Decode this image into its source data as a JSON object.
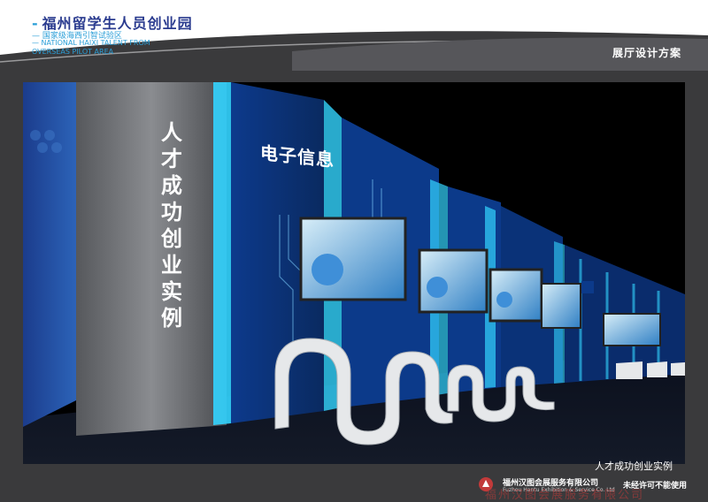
{
  "header": {
    "title": "福州留学生人员创业园",
    "subtitle_cn": "国家级海西引智试验区",
    "subtitle_en_line1": "NATIONAL HAIXI TALENT FROM",
    "subtitle_en_line2": "OVERSEAS PILOT AREA",
    "section_label": "展厅设计方案"
  },
  "scene": {
    "vertical_sign": [
      "人",
      "才",
      "成",
      "功",
      "创",
      "业",
      "实",
      "例"
    ],
    "wall_heading": "电子信息",
    "caption": "人才成功创业实例"
  },
  "footer": {
    "company_cn": "福州汉图会展服务有限公司",
    "company_en": "Fuzhou Hantu Exhibition & Service Co. Ltd",
    "notice": "未经许可不能使用",
    "watermark": "福州汉图会展服务有限公司"
  },
  "colors": {
    "accent_blue": "#2b9fd8",
    "title_navy": "#2a3b8f",
    "glow_cyan": "#33d4ff",
    "panel_blue": "#0c3a8a",
    "header_grey": "#4a4a4e"
  }
}
